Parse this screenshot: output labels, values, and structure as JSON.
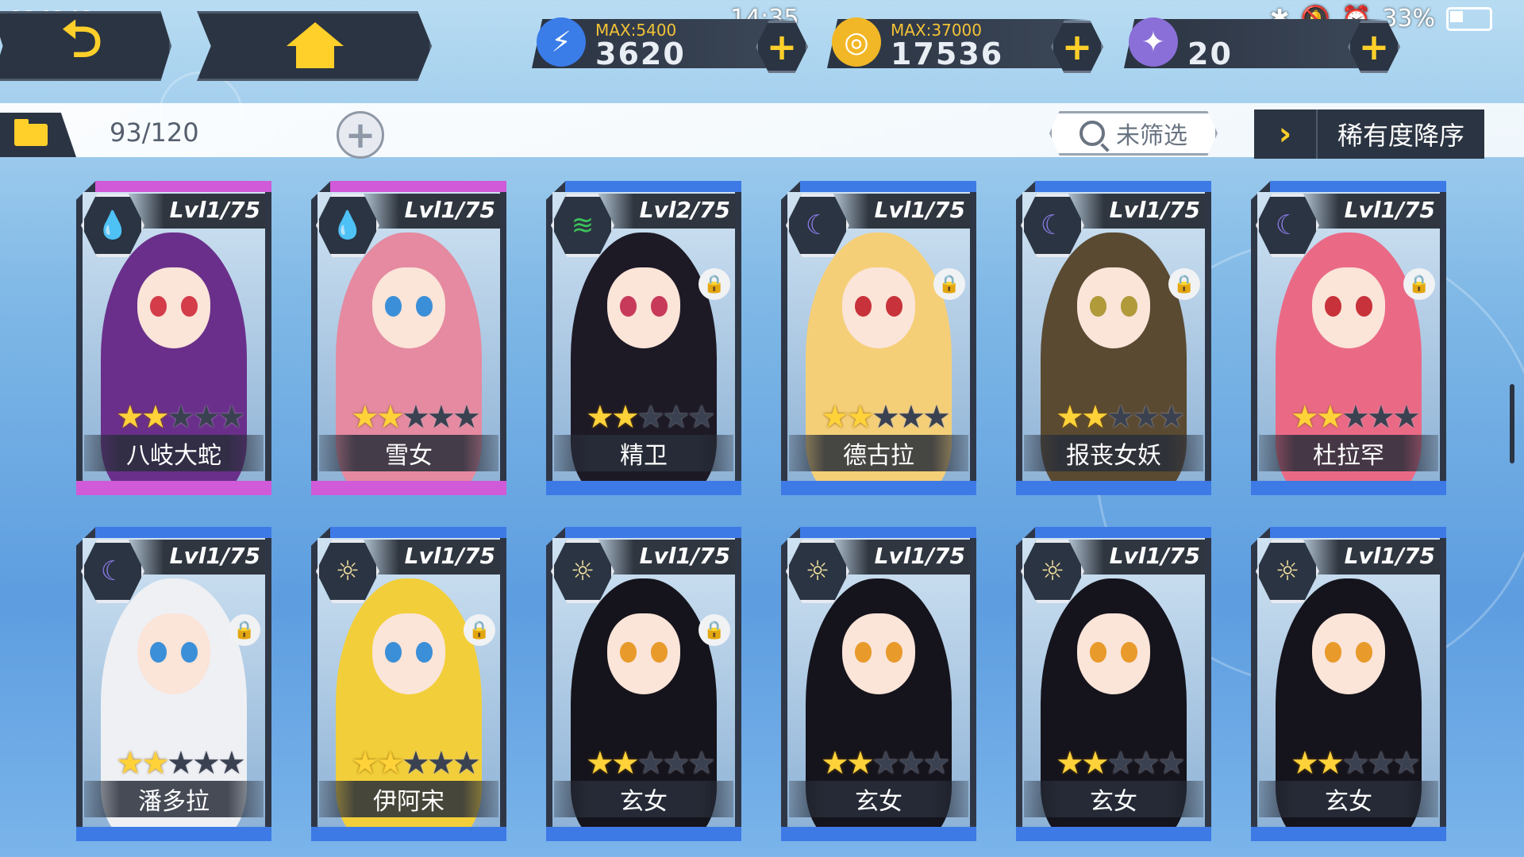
{
  "status_bar": {
    "signal": "2G 4G 4G ···",
    "time": "14:35",
    "battery": "33%"
  },
  "resources": [
    {
      "name": "stamina",
      "icon": "battery-bolt-icon",
      "max": "MAX:5400",
      "value": "3620",
      "color": "#3a7ce8"
    },
    {
      "name": "gold",
      "icon": "coin-icon",
      "max": "MAX:37000",
      "value": "17536",
      "color": "#f2b726"
    },
    {
      "name": "gems",
      "icon": "crystal-icon",
      "max": "",
      "value": "20",
      "color": "#8a6fd8"
    }
  ],
  "filter_bar": {
    "count": "93/120",
    "search_label": "未筛选",
    "sort_label": "稀有度降序"
  },
  "colors": {
    "purple": "#d05ad8",
    "blue": "#3d7ae6",
    "accent": "#ffcf2a",
    "dark": "#2b3442"
  },
  "cards": [
    {
      "name": "八岐大蛇",
      "level": "Lvl1/75",
      "element": "water",
      "element_glyph": "💧",
      "stars": 2,
      "locked": false,
      "rarity_color": "#d05ad8",
      "hair": "#6a2f8a",
      "eye": "#d43c4a"
    },
    {
      "name": "雪女",
      "level": "Lvl1/75",
      "element": "water",
      "element_glyph": "💧",
      "stars": 2,
      "locked": false,
      "rarity_color": "#d05ad8",
      "hair": "#e58aa0",
      "eye": "#3b8fd8"
    },
    {
      "name": "精卫",
      "level": "Lvl2/75",
      "element": "wind",
      "element_glyph": "≋",
      "stars": 2,
      "locked": true,
      "rarity_color": "#3d7ae6",
      "hair": "#1d1a26",
      "eye": "#c83a5a"
    },
    {
      "name": "德古拉",
      "level": "Lvl1/75",
      "element": "moon",
      "element_glyph": "☾",
      "stars": 2,
      "locked": true,
      "rarity_color": "#3d7ae6",
      "hair": "#f5cf78",
      "eye": "#c8323a"
    },
    {
      "name": "报丧女妖",
      "level": "Lvl1/75",
      "element": "moon",
      "element_glyph": "☾",
      "stars": 2,
      "locked": true,
      "rarity_color": "#3d7ae6",
      "hair": "#5a4a32",
      "eye": "#b09a3a"
    },
    {
      "name": "杜拉罕",
      "level": "Lvl1/75",
      "element": "moon",
      "element_glyph": "☾",
      "stars": 2,
      "locked": true,
      "rarity_color": "#3d7ae6",
      "hair": "#ea6a86",
      "eye": "#c8323a"
    },
    {
      "name": "潘多拉",
      "level": "Lvl1/75",
      "element": "moon",
      "element_glyph": "☾",
      "stars": 2,
      "locked": true,
      "rarity_color": "#3d7ae6",
      "hair": "#eef0f4",
      "eye": "#3b8fd8"
    },
    {
      "name": "伊阿宋",
      "level": "Lvl1/75",
      "element": "sun",
      "element_glyph": "☼",
      "stars": 2,
      "locked": true,
      "rarity_color": "#3d7ae6",
      "hair": "#f2cf3a",
      "eye": "#3b8fd8"
    },
    {
      "name": "玄女",
      "level": "Lvl1/75",
      "element": "sun",
      "element_glyph": "☼",
      "stars": 2,
      "locked": true,
      "rarity_color": "#3d7ae6",
      "hair": "#15141c",
      "eye": "#e89a2a"
    },
    {
      "name": "玄女",
      "level": "Lvl1/75",
      "element": "sun",
      "element_glyph": "☼",
      "stars": 2,
      "locked": false,
      "rarity_color": "#3d7ae6",
      "hair": "#15141c",
      "eye": "#e89a2a"
    },
    {
      "name": "玄女",
      "level": "Lvl1/75",
      "element": "sun",
      "element_glyph": "☼",
      "stars": 2,
      "locked": false,
      "rarity_color": "#3d7ae6",
      "hair": "#15141c",
      "eye": "#e89a2a"
    },
    {
      "name": "玄女",
      "level": "Lvl1/75",
      "element": "sun",
      "element_glyph": "☼",
      "stars": 2,
      "locked": false,
      "rarity_color": "#3d7ae6",
      "hair": "#15141c",
      "eye": "#e89a2a"
    }
  ],
  "max_stars": 5
}
